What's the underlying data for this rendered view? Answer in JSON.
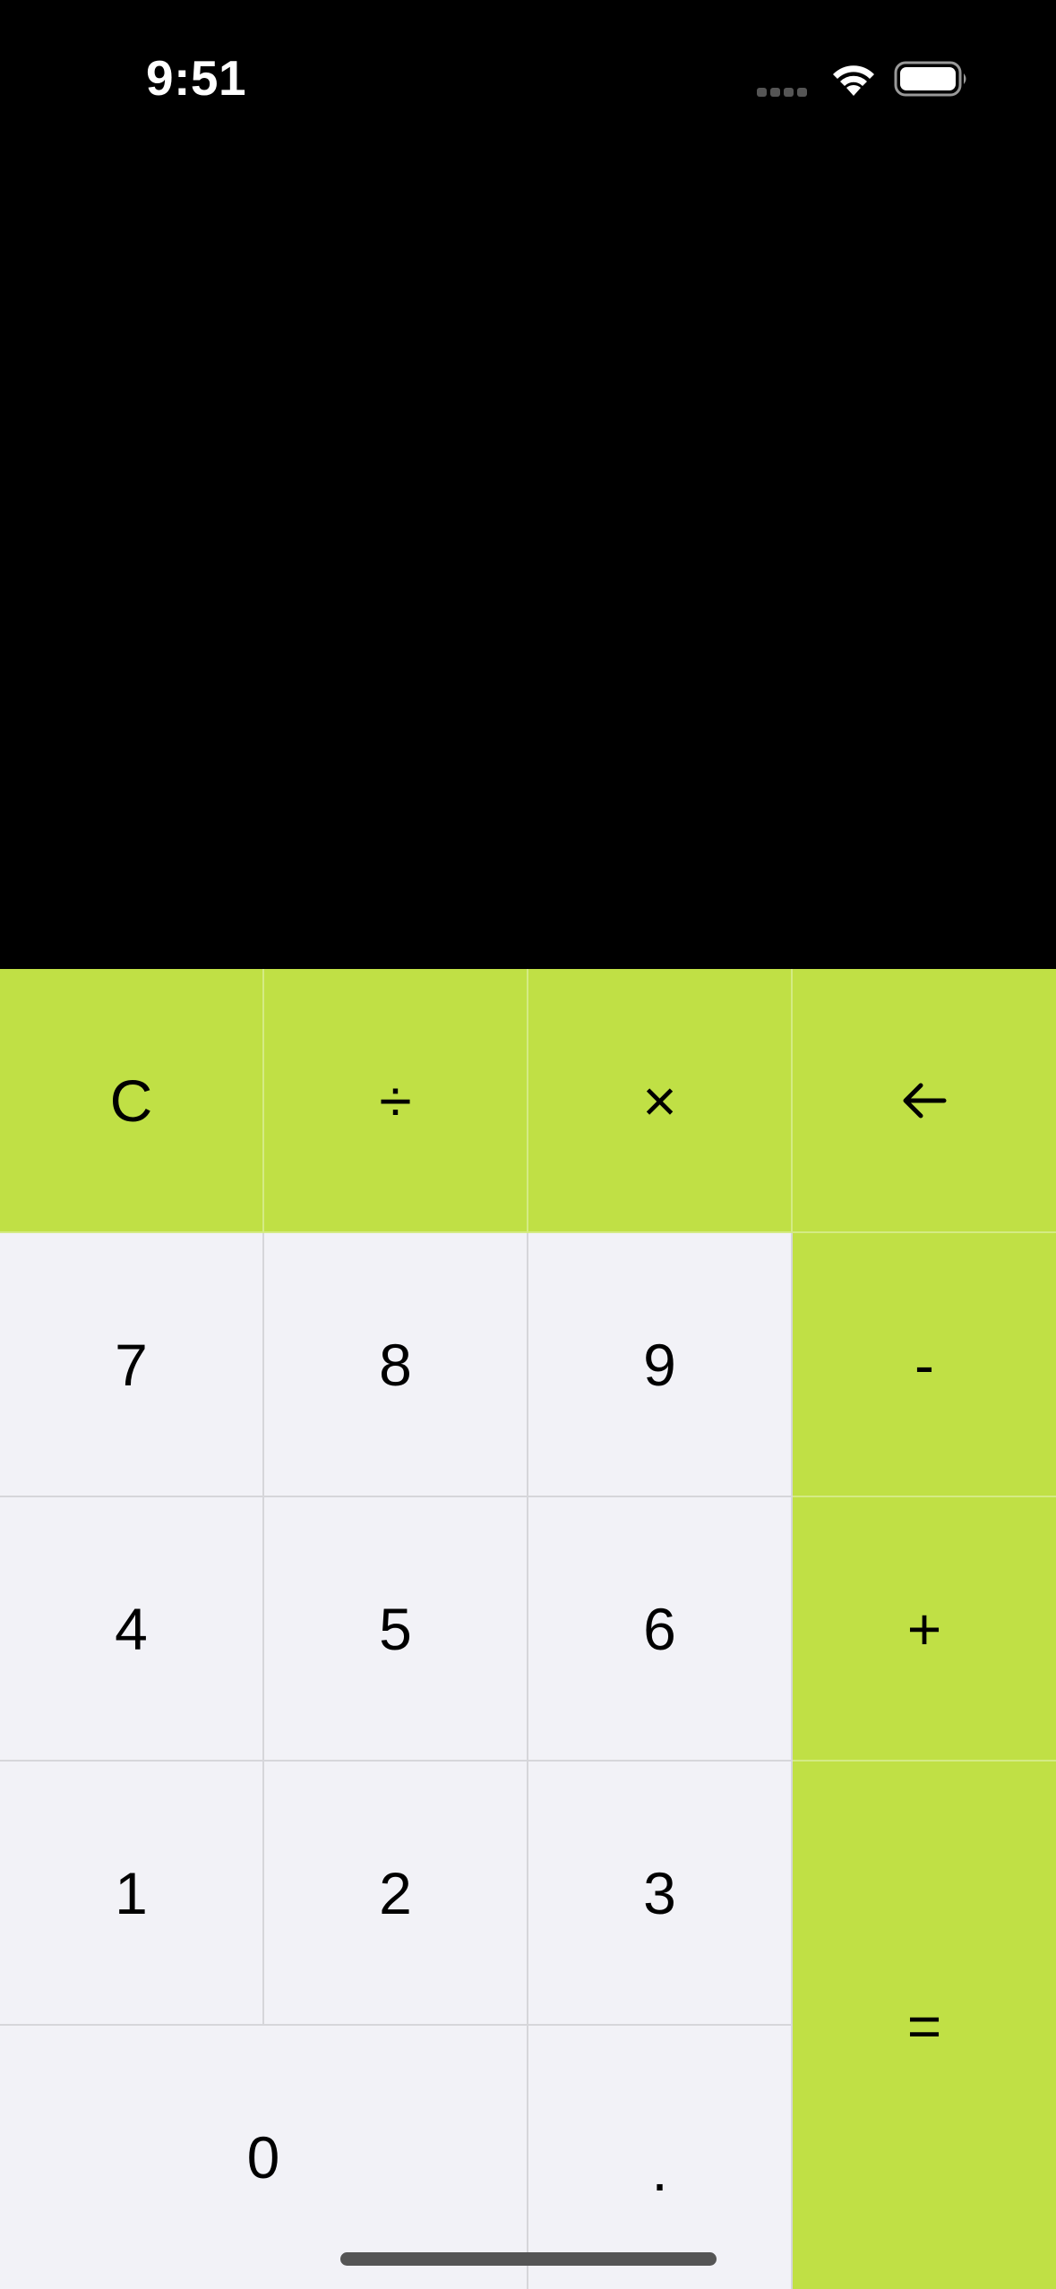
{
  "status_bar": {
    "time": "9:51",
    "signal_icon": "signal-dots-icon",
    "wifi_icon": "wifi-icon",
    "battery_icon": "battery-icon"
  },
  "display": {
    "value": ""
  },
  "keypad": {
    "clear": "C",
    "divide": "÷",
    "multiply": "×",
    "backspace_icon": "backspace-arrow-icon",
    "seven": "7",
    "eight": "8",
    "nine": "9",
    "minus": "-",
    "four": "4",
    "five": "5",
    "six": "6",
    "plus": "+",
    "one": "1",
    "two": "2",
    "three": "3",
    "equals": "=",
    "zero": "0",
    "decimal": "."
  },
  "colors": {
    "operator_bg": "#c0e045",
    "number_bg": "#f2f2f7",
    "display_bg": "#000000"
  }
}
